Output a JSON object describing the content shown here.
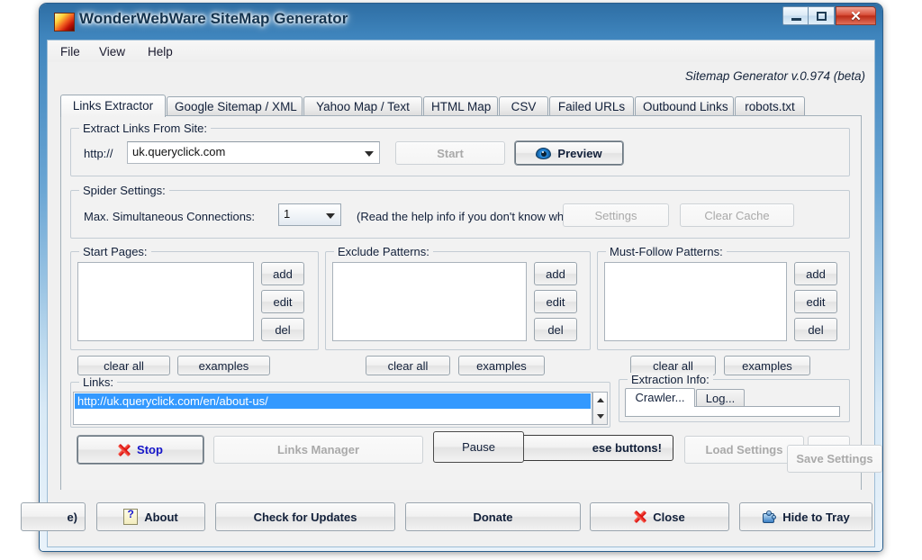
{
  "window": {
    "title": "WonderWebWare SiteMap Generator",
    "icon": "app-logo-icon",
    "minimize": "–",
    "maximize": "□",
    "close": "✕"
  },
  "menu": {
    "items": [
      "File",
      "View",
      "Help"
    ]
  },
  "version_line": "Sitemap Generator v.0.974 (beta)",
  "tabs": [
    {
      "label": "Links Extractor",
      "active": true
    },
    {
      "label": "Google Sitemap / XML",
      "active": false
    },
    {
      "label": "Yahoo Map / Text",
      "active": false
    },
    {
      "label": "HTML Map",
      "active": false
    },
    {
      "label": "CSV",
      "active": false
    },
    {
      "label": "Failed URLs",
      "active": false
    },
    {
      "label": "Outbound Links",
      "active": false
    },
    {
      "label": "robots.txt",
      "active": false
    }
  ],
  "extract_group": {
    "legend": "Extract Links From Site:",
    "protocol_label": "http://",
    "url_value": "uk.queryclick.com",
    "url_placeholder": "",
    "start_button": "Start",
    "preview_button": "Preview"
  },
  "spider_group": {
    "legend": "Spider Settings:",
    "connections_label": "Max. Simultaneous Connections:",
    "connections_value": "1",
    "hint_text": "(Read the help info if you don't know what is t",
    "settings_button": "Settings",
    "clear_cache_button": "Clear Cache"
  },
  "panels": [
    {
      "legend": "Start Pages:",
      "items": [],
      "add": "add",
      "edit": "edit",
      "del": "del",
      "clear_all": "clear all",
      "examples": "examples"
    },
    {
      "legend": "Exclude Patterns:",
      "items": [],
      "add": "add",
      "edit": "edit",
      "del": "del",
      "clear_all": "clear all",
      "examples": "examples"
    },
    {
      "legend": "Must-Follow Patterns:",
      "items": [],
      "add": "add",
      "edit": "edit",
      "del": "del",
      "clear_all": "clear all",
      "examples": "examples"
    }
  ],
  "links_group": {
    "legend": "Links:",
    "selected_link": "http://uk.queryclick.com/en/about-us/",
    "highlight_color": "#3399ff"
  },
  "extraction_info": {
    "legend": "Extraction Info:",
    "tabs": [
      {
        "label": "Crawler...",
        "active": true
      },
      {
        "label": "Log...",
        "active": false
      }
    ]
  },
  "action_bar": {
    "stop_button": "Stop",
    "links_manager_button": "Links Manager",
    "pause_button": "Pause",
    "overlapped_button": "ese buttons!",
    "load_settings_button": "Load Settings",
    "save_settings_button": "Save Settings"
  },
  "bottom_bar": {
    "cut_button": "e)",
    "about_button": "About",
    "check_updates_button": "Check for Updates",
    "donate_button": "Donate",
    "close_button": "Close",
    "hide_tray_button": "Hide to Tray"
  }
}
